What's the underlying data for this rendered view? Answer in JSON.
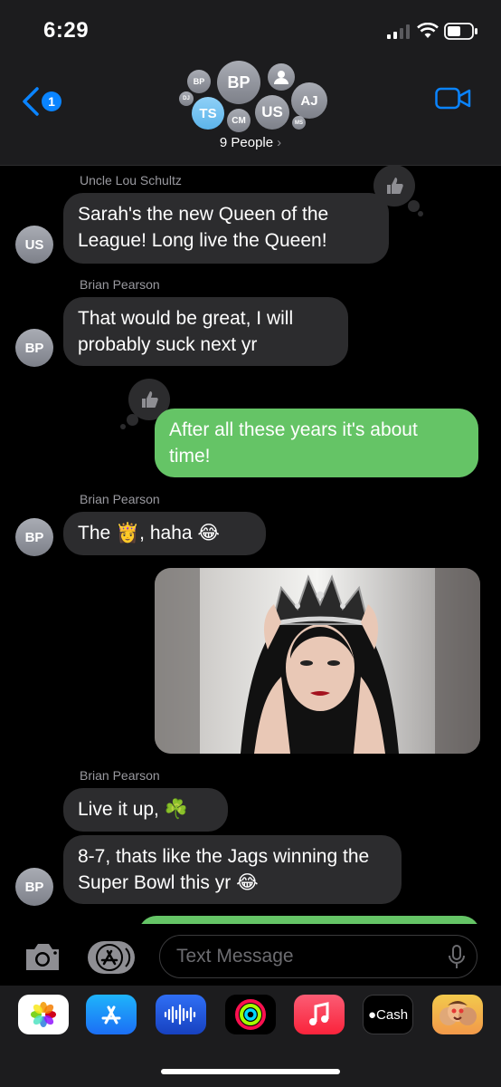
{
  "status": {
    "time": "6:29"
  },
  "header": {
    "back_badge": "1",
    "people_label": "9 People",
    "avatars": {
      "bp_small": "BP",
      "bp": "BP",
      "aj": "AJ",
      "dj": "DJ",
      "ts": "TS",
      "cm": "CM",
      "us": "US",
      "ms": "MS"
    }
  },
  "messages": [
    {
      "sender": "Uncle Lou Schultz",
      "avatar": "US",
      "text": "Sarah's the new Queen of the League! Long live the Queen!"
    },
    {
      "sender": "Brian Pearson",
      "avatar": "BP",
      "text": "That would be great, I will probably suck next yr"
    },
    {
      "sender": "",
      "text": "After all these years it's about time!"
    },
    {
      "sender": "Brian Pearson",
      "avatar": "BP",
      "text": "The 👸, haha 😂"
    },
    {
      "sender": "Brian Pearson",
      "text": "Live it up, ☘️"
    },
    {
      "avatar": "BP",
      "text": "8-7, thats like the Jags winning the Super Bowl this yr 😂"
    }
  ],
  "compose": {
    "placeholder": "Text Message"
  },
  "apps": {
    "cash_label": "Cash"
  },
  "colors": {
    "outgoing": "#65c466",
    "incoming": "#2c2c2e",
    "accent": "#0a84ff"
  }
}
